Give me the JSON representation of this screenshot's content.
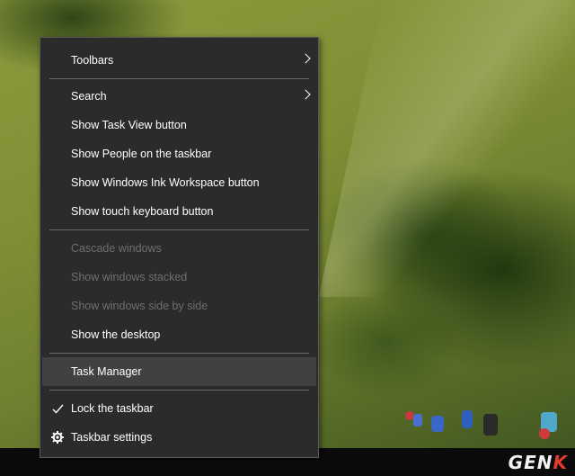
{
  "context_menu": {
    "items": [
      {
        "label": "Toolbars"
      },
      {
        "label": "Search"
      },
      {
        "label": "Show Task View button"
      },
      {
        "label": "Show People on the taskbar"
      },
      {
        "label": "Show Windows Ink Workspace button"
      },
      {
        "label": "Show touch keyboard button"
      },
      {
        "label": "Cascade windows"
      },
      {
        "label": "Show windows stacked"
      },
      {
        "label": "Show windows side by side"
      },
      {
        "label": "Show the desktop"
      },
      {
        "label": "Task Manager"
      },
      {
        "label": "Lock the taskbar"
      },
      {
        "label": "Taskbar settings"
      }
    ],
    "icons": {
      "submenu": "chevron-right-icon",
      "checked": "checkmark-icon",
      "settings": "gear-icon"
    },
    "colors": {
      "background": "#2b2b2b",
      "text": "#ffffff",
      "disabled_text": "#6e6e6e",
      "hover": "#414141",
      "separator": "#6a6a6a"
    }
  },
  "watermark": {
    "text_main": "GEN",
    "text_accent": "K",
    "accent_color": "#e23b2e"
  }
}
